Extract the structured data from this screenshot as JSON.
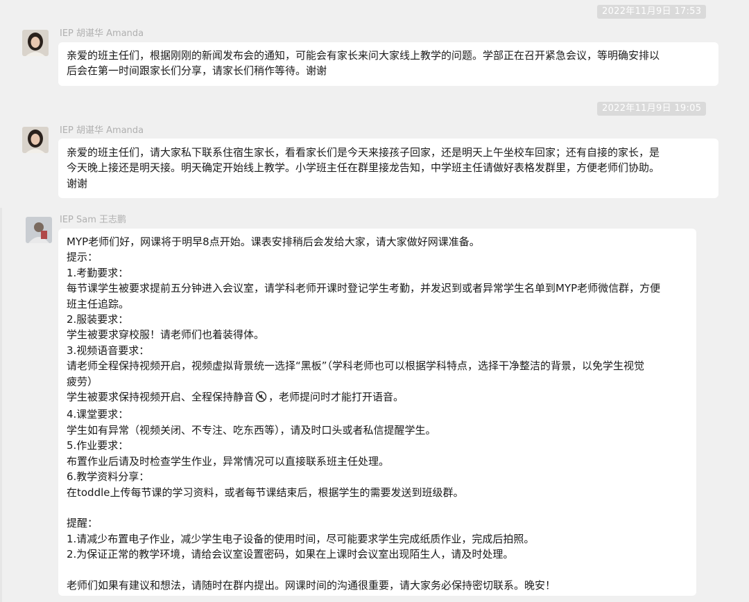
{
  "messages": [
    {
      "timestamp": "2022年11月9日 17:53",
      "sender": "IEP 胡谌华 Amanda",
      "avatar": "avatar-woman",
      "lines": [
        "亲爱的班主任们，根据刚刚的新闻发布会的通知，可能会有家长来问大家线上教学的问题。学部正在召开紧急会议，等明确安排以",
        "后会在第一时间跟家长们分享，请家长们稍作等待。谢谢"
      ]
    },
    {
      "timestamp": "2022年11月9日 19:05",
      "sender": "IEP 胡谌华 Amanda",
      "avatar": "avatar-woman",
      "lines": [
        "亲爱的班主任们，请大家私下联系住宿生家长，看看家长们是今天来接孩子回家，还是明天上午坐校车回家；还有自接的家长，是",
        "今天晚上接还是明天接。明天确定开始线上教学。小学班主任在群里接龙告知，中学班主任请做好表格发群里，方便老师们协助。",
        "谢谢"
      ]
    },
    {
      "sender": "IEP Sam 王志鹏",
      "avatar": "avatar-man",
      "lines": [
        "MYP老师们好，网课将于明早8点开始。课表安排稍后会发给大家，请大家做好网课准备。",
        "提示：",
        "1.考勤要求：",
        "每节课学生被要求提前五分钟进入会议室，请学科老师开课时登记学生考勤，并发迟到或者异常学生名单到MYP老师微信群，方便",
        "班主任追踪。",
        "2.服装要求：",
        "学生被要求穿校服！请老师们也着装得体。",
        "3.视频语音要求：",
        "请老师全程保持视频开启，视频虚拟背景统一选择“黑板”（学科老师也可以根据学科特点，选择干净整洁的背景，以免学生视觉",
        "疲劳）",
        "学生被要求保持视频开启、全程保持静音",
        "4.课堂要求：",
        "学生如有异常（视频关闭、不专注、吃东西等），请及时口头或者私信提醒学生。",
        "5.作业要求：",
        "布置作业后请及时检查学生作业，异常情况可以直接联系班主任处理。",
        "6.教学资料分享：",
        "在toddle上传每节课的学习资料，或者每节课结束后，根据学生的需要发送到班级群。",
        "",
        "提醒：",
        "1.请减少布置电子作业，减少学生电子设备的使用时间，尽可能要求学生完成纸质作业，完成后拍照。",
        "2.为保证正常的教学环境，请给会议室设置密码，如果在上课时会议室出现陌生人，请及时处理。",
        "",
        "老师们如果有建议和想法，请随时在群内提出。网课时间的沟通很重要，请大家务必保持密切联系。晚安！"
      ],
      "mute_line_suffix": "，老师提问时才能打开语音。",
      "mute_icon": "mute-icon"
    }
  ]
}
